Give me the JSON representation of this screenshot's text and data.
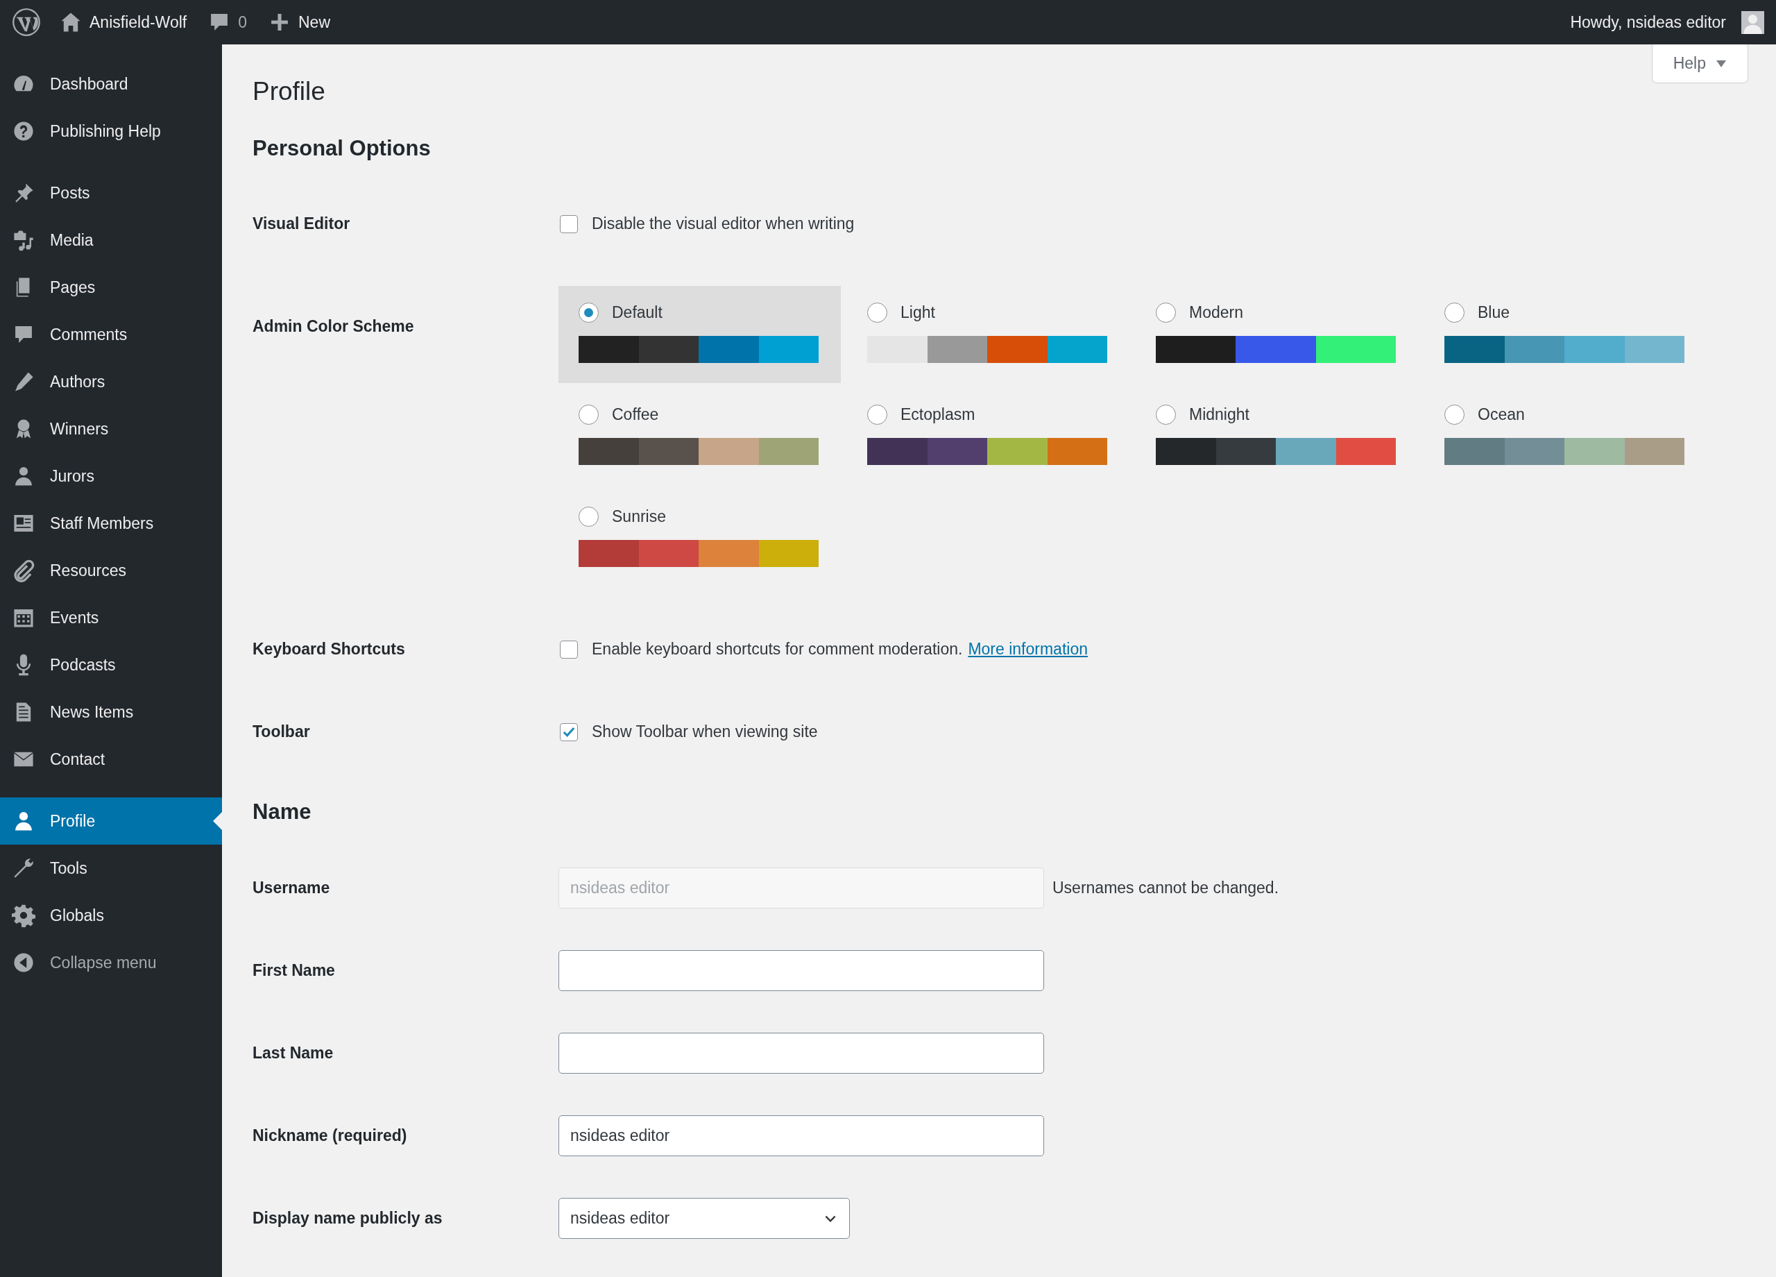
{
  "top_bar": {
    "site_name": "Anisfield-Wolf",
    "comments_count": "0",
    "new_label": "New",
    "greeting": "Howdy, nsideas editor"
  },
  "sidebar": {
    "groups": [
      {
        "items": [
          {
            "label": "Dashboard",
            "selected": false
          },
          {
            "label": "Publishing Help",
            "selected": false
          }
        ]
      },
      {
        "items": [
          {
            "label": "Posts",
            "selected": false
          },
          {
            "label": "Media",
            "selected": false
          },
          {
            "label": "Pages",
            "selected": false
          },
          {
            "label": "Comments",
            "selected": false
          },
          {
            "label": "Authors",
            "selected": false
          },
          {
            "label": "Winners",
            "selected": false
          },
          {
            "label": "Jurors",
            "selected": false
          },
          {
            "label": "Staff Members",
            "selected": false
          },
          {
            "label": "Resources",
            "selected": false
          },
          {
            "label": "Events",
            "selected": false
          },
          {
            "label": "Podcasts",
            "selected": false
          },
          {
            "label": "News Items",
            "selected": false
          },
          {
            "label": "Contact",
            "selected": false
          }
        ]
      },
      {
        "items": [
          {
            "label": "Profile",
            "selected": true
          },
          {
            "label": "Tools",
            "selected": false
          },
          {
            "label": "Globals",
            "selected": false
          }
        ]
      }
    ],
    "collapse": "Collapse menu"
  },
  "help": {
    "label": "Help"
  },
  "page_title": "Profile",
  "personal_options": {
    "heading": "Personal Options",
    "visual_editor": {
      "label": "Visual Editor",
      "option": "Disable the visual editor when writing",
      "checked": false
    },
    "color_scheme": {
      "label": "Admin Color Scheme",
      "schemes": [
        {
          "name": "Default",
          "selected": true,
          "swatches": [
            {
              "color": "#222222"
            },
            {
              "color": "#333333"
            },
            {
              "color": "#0073aa"
            },
            {
              "color": "#00a0d2"
            }
          ]
        },
        {
          "name": "Light",
          "selected": false,
          "swatches": [
            {
              "color": "#e5e5e5"
            },
            {
              "color": "#999999"
            },
            {
              "color": "#d64e07"
            },
            {
              "color": "#04a4cc"
            }
          ]
        },
        {
          "name": "Modern",
          "selected": false,
          "swatches": [
            {
              "color": "#1e1e1e"
            },
            {
              "color": "#3858e9"
            },
            {
              "color": "#33f078"
            }
          ]
        },
        {
          "name": "Blue",
          "selected": false,
          "swatches": [
            {
              "color": "#096484"
            },
            {
              "color": "#4796b3"
            },
            {
              "color": "#52accc"
            },
            {
              "color": "#74b6ce"
            }
          ]
        },
        {
          "name": "Coffee",
          "selected": false,
          "swatches": [
            {
              "color": "#46403c"
            },
            {
              "color": "#59524c"
            },
            {
              "color": "#c7a589"
            },
            {
              "color": "#9ea476"
            }
          ]
        },
        {
          "name": "Ectoplasm",
          "selected": false,
          "swatches": [
            {
              "color": "#413256"
            },
            {
              "color": "#523f6d"
            },
            {
              "color": "#a3b745"
            },
            {
              "color": "#d46f15"
            }
          ]
        },
        {
          "name": "Midnight",
          "selected": false,
          "swatches": [
            {
              "color": "#25282b"
            },
            {
              "color": "#363b3f"
            },
            {
              "color": "#69a8bb"
            },
            {
              "color": "#e14d43"
            }
          ]
        },
        {
          "name": "Ocean",
          "selected": false,
          "swatches": [
            {
              "color": "#627c83"
            },
            {
              "color": "#738e96"
            },
            {
              "color": "#9ebaa0"
            },
            {
              "color": "#aa9d88"
            }
          ]
        },
        {
          "name": "Sunrise",
          "selected": false,
          "swatches": [
            {
              "color": "#b43c38"
            },
            {
              "color": "#cf4944"
            },
            {
              "color": "#dd823b"
            },
            {
              "color": "#ccaf0b"
            }
          ]
        }
      ]
    },
    "keyboard_shortcuts": {
      "label": "Keyboard Shortcuts",
      "option": "Enable keyboard shortcuts for comment moderation.",
      "link": "More information",
      "checked": false
    },
    "toolbar": {
      "label": "Toolbar",
      "option": "Show Toolbar when viewing site",
      "checked": true
    }
  },
  "name_section": {
    "heading": "Name",
    "fields": [
      {
        "kind": "text",
        "label": "Username",
        "value": "nsideas editor",
        "disabled": true,
        "note": "Usernames cannot be changed."
      },
      {
        "kind": "text",
        "label": "First Name",
        "disabled": false
      },
      {
        "kind": "text",
        "label": "Last Name",
        "disabled": false
      },
      {
        "kind": "text",
        "label": "Nickname (required)",
        "value": "nsideas editor",
        "disabled": false
      },
      {
        "kind": "select",
        "label": "Display name publicly as",
        "value": "nsideas editor"
      }
    ]
  }
}
